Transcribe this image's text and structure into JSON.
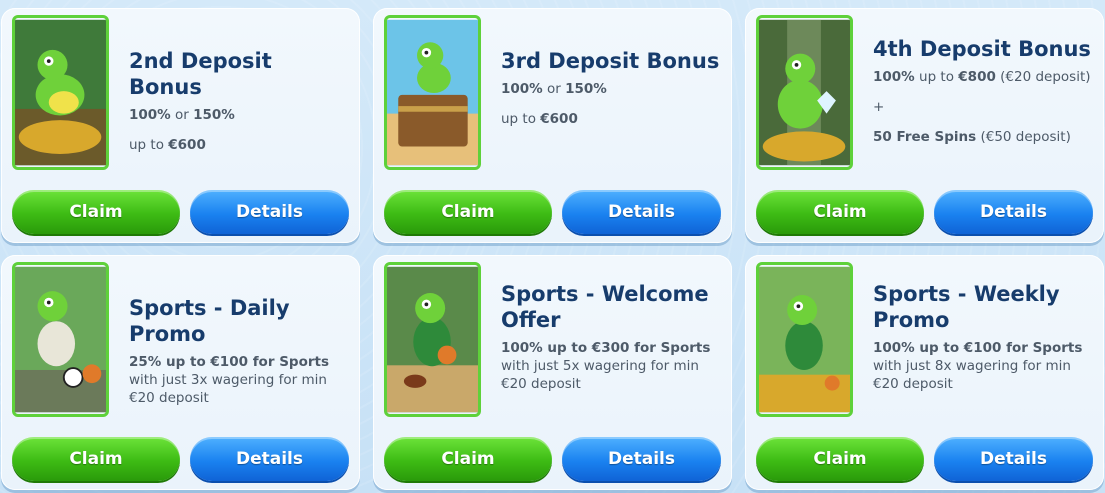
{
  "cards": [
    {
      "title": "2nd Deposit Bonus",
      "line1_a": "100%",
      "line1_b": " or ",
      "line1_c": "150%",
      "line2_a": "up to ",
      "line2_b": "€600",
      "image": "chameleon-on-coins-icon",
      "claim_label": "Claim",
      "details_label": "Details"
    },
    {
      "title": "3rd Deposit Bonus",
      "line1_a": "100%",
      "line1_b": " or ",
      "line1_c": "150%",
      "line2_a": "up to ",
      "line2_b": "€600",
      "image": "chameleon-treasure-chest-icon",
      "claim_label": "Claim",
      "details_label": "Details"
    },
    {
      "title": "4th Deposit Bonus",
      "line1_a": "100%",
      "line1_b": " up to ",
      "line1_c": "€800",
      "line1_d": " (€20 deposit)",
      "plus": "+",
      "line3_a": "50 Free Spins",
      "line3_b": " (€50 deposit)",
      "image": "chameleon-diamond-icon",
      "claim_label": "Claim",
      "details_label": "Details"
    },
    {
      "title": "Sports - Daily Promo",
      "desc_bold": "25% up to €100 for Sports",
      "desc_rest": " with just 3x wagering for min €20 deposit",
      "image": "chameleon-football-icon",
      "claim_label": "Claim",
      "details_label": "Details"
    },
    {
      "title": "Sports - Welcome Offer",
      "desc_bold": "100% up to €300 for Sports",
      "desc_rest": " with just 5x wagering for min €20 deposit",
      "image": "chameleon-basketball-icon",
      "claim_label": "Claim",
      "details_label": "Details"
    },
    {
      "title": "Sports - Weekly Promo",
      "desc_bold": "100% up to €100 for Sports",
      "desc_rest": " with just 8x wagering for min €20 deposit",
      "image": "chameleon-jersey-icon",
      "claim_label": "Claim",
      "details_label": "Details"
    }
  ],
  "colors": {
    "accent_green": "#3dbb14",
    "accent_blue": "#1a82f0",
    "title_navy": "#173c6c",
    "thumb_border": "#5ed13a"
  }
}
